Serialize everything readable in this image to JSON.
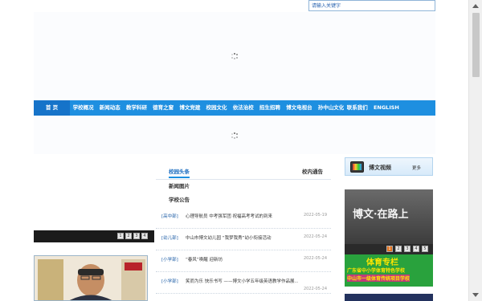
{
  "search": {
    "placeholder": "请输入关键字"
  },
  "nav": {
    "items": [
      "首 页",
      "学校概况",
      "新闻动态",
      "教学科研",
      "德育之窗",
      "博文党建",
      "校园文化",
      "依法治校",
      "招生招聘",
      "博文电视台",
      "孙中山文化",
      "联系我们",
      "ENGLISH"
    ]
  },
  "slider": {
    "pages": [
      "1",
      "2",
      "3",
      "4"
    ]
  },
  "news": {
    "tabs": [
      "校园头条",
      "校内通告",
      "新闻图片",
      "学校公告"
    ],
    "rows": [
      {
        "cat": "[高中部]",
        "title": "心理导航员 中考强军团 祝福高考考试的到来",
        "date": "2022-05-19"
      },
      {
        "cat": "[幼儿部]",
        "title": "中山市博文幼儿园 “我梦我秀”幼小衔接活动",
        "date": "2022-05-24"
      },
      {
        "cat": "[小学部]",
        "title": "“春风”唤醒 迎新坊",
        "date": "2022-05-24"
      },
      {
        "cat": "[小学部]",
        "title": "笑而为乐 快乐书写 ——博文小学五年级英语教学作品展...",
        "date": "2022-05-24"
      }
    ]
  },
  "video": {
    "title": "博文视频",
    "more": "更多",
    "thumb_text": "博文·在路上",
    "pages": [
      "1",
      "2",
      "3",
      "4",
      "5"
    ]
  },
  "pe": {
    "title": "体育专栏",
    "line1": "广东省中小学体育特色学校",
    "line2": "中山市一级体育传统项目学校"
  },
  "colors": {
    "nav": "#1e8fe0",
    "nav_home": "#1673c9",
    "link": "#2361a8"
  }
}
